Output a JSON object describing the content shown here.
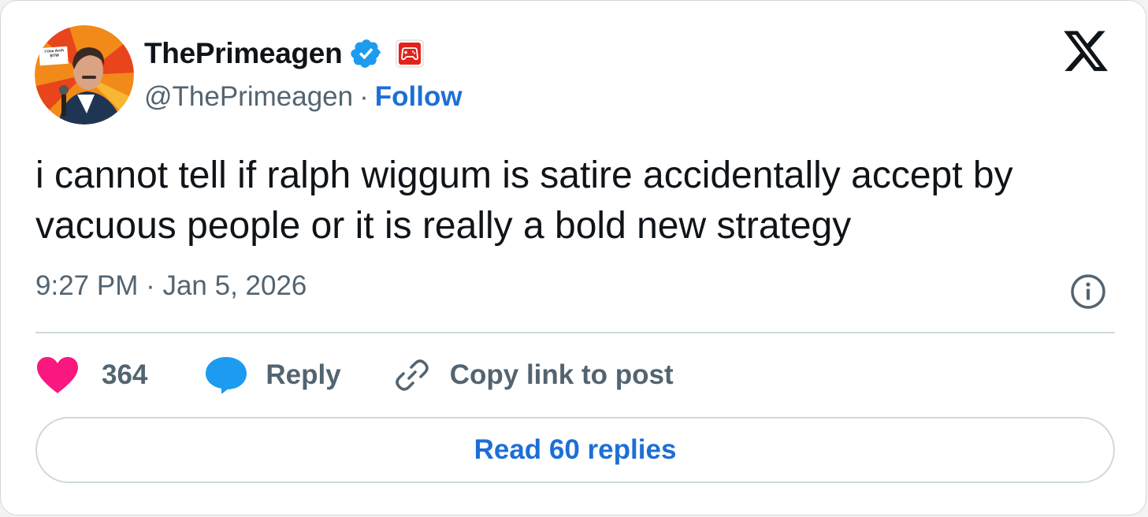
{
  "author": {
    "display_name": "ThePrimeagen",
    "handle": "@ThePrimeagen",
    "separator": "·",
    "follow_label": "Follow",
    "avatar_sign_text": "I Use Arch BTW"
  },
  "tweet": {
    "text": "i cannot tell if ralph wiggum is satire accidentally accept by vacuous people or it is really a bold new strategy",
    "timestamp": "9:27 PM · Jan 5, 2026"
  },
  "actions": {
    "like_count": "364",
    "reply_label": "Reply",
    "copy_link_label": "Copy link to post"
  },
  "read_replies_label": "Read 60 replies",
  "icons": {
    "verified": "verified-badge-icon",
    "affiliation": "gamepad-icon",
    "platform": "x-logo-icon",
    "info": "info-icon",
    "like": "heart-icon",
    "reply": "speech-bubble-icon",
    "link": "link-icon"
  },
  "colors": {
    "accent": "#1d6fd6",
    "like": "#f91880",
    "reply": "#1d9bf0",
    "text_primary": "#0f1419",
    "text_secondary": "#536471"
  }
}
